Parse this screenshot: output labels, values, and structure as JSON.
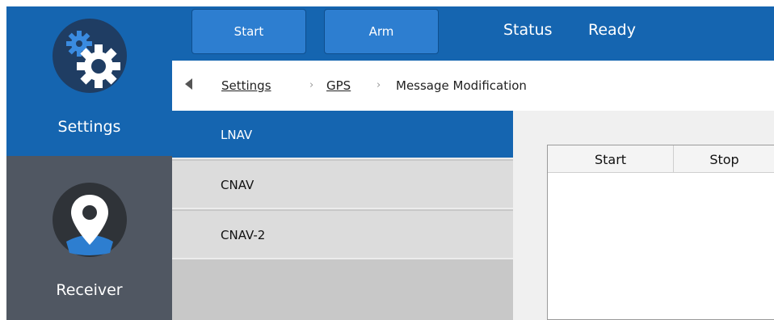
{
  "nav": {
    "items": [
      {
        "label": "Settings",
        "icon": "settings-gears-icon",
        "selected": true
      },
      {
        "label": "Receiver",
        "icon": "location-pin-icon",
        "selected": false
      }
    ]
  },
  "toolbar": {
    "start_label": "Start",
    "arm_label": "Arm",
    "status_label": "Status",
    "status_value": "Ready"
  },
  "breadcrumb": {
    "items": [
      "Settings",
      "GPS",
      "Message Modification"
    ]
  },
  "message_types": {
    "items": [
      "LNAV",
      "CNAV",
      "CNAV-2"
    ],
    "selected": "LNAV"
  },
  "table": {
    "columns": [
      "Start",
      "Stop"
    ],
    "rows": []
  },
  "colors": {
    "accent": "#1565b0",
    "nav_dark": "#505762",
    "list_item": "#dcdcdc"
  }
}
